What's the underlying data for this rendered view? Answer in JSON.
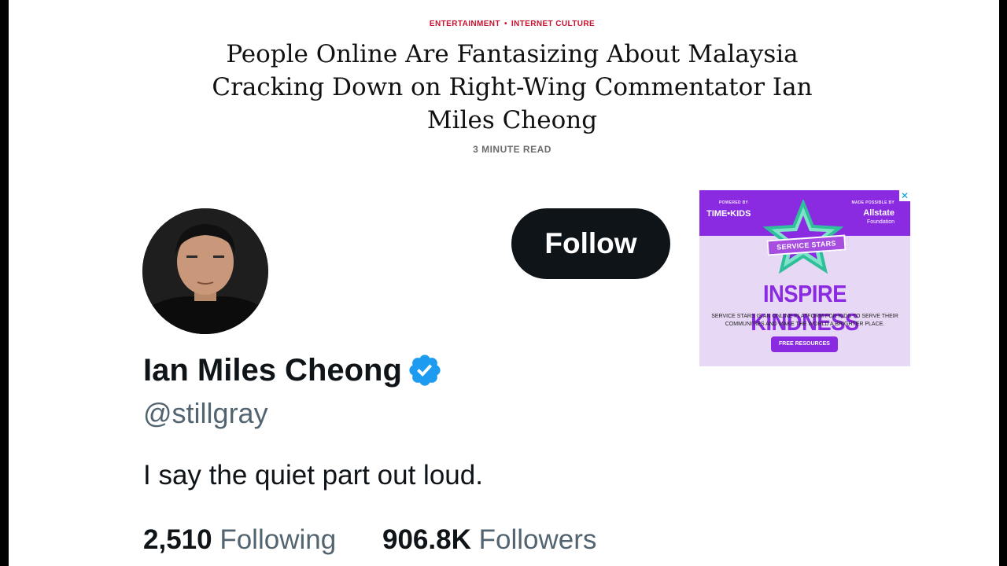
{
  "article": {
    "kicker_primary": "ENTERTAINMENT",
    "kicker_separator": "•",
    "kicker_secondary": "INTERNET CULTURE",
    "headline": "People Online Are Fantasizing About Malaysia Cracking Down on Right-Wing Commentator Ian Miles Cheong",
    "read_time": "3 MINUTE READ",
    "accent_color": "#c8102e"
  },
  "profile": {
    "follow_label": "Follow",
    "display_name": "Ian Miles Cheong",
    "verified_icon": "verified-badge-icon",
    "handle": "@stillgray",
    "bio": "I say the quiet part out loud.",
    "following_count": "2,510",
    "following_label": "Following",
    "followers_count": "906.8K",
    "followers_label": "Followers",
    "verified_color": "#1d9bf0"
  },
  "ad": {
    "powered_by": "POWERED BY",
    "brand_left": "TIME•KIDS",
    "made_possible_by": "MADE POSSIBLE BY",
    "brand_right": "Allstate",
    "brand_right_sub": "Foundation",
    "badge_text": "SERVICE STARS",
    "headline": "INSPIRE KINDNESS",
    "body": "SERVICE STARS IS AN ONLINE PLATFORM FOR KIDS TO SERVE THEIR COMMUNITIES AND MAKE THE WORLD A BRIGHTER PLACE.",
    "cta": "FREE RESOURCES",
    "close_glyph": "✕",
    "accent_color": "#8a2be2"
  }
}
